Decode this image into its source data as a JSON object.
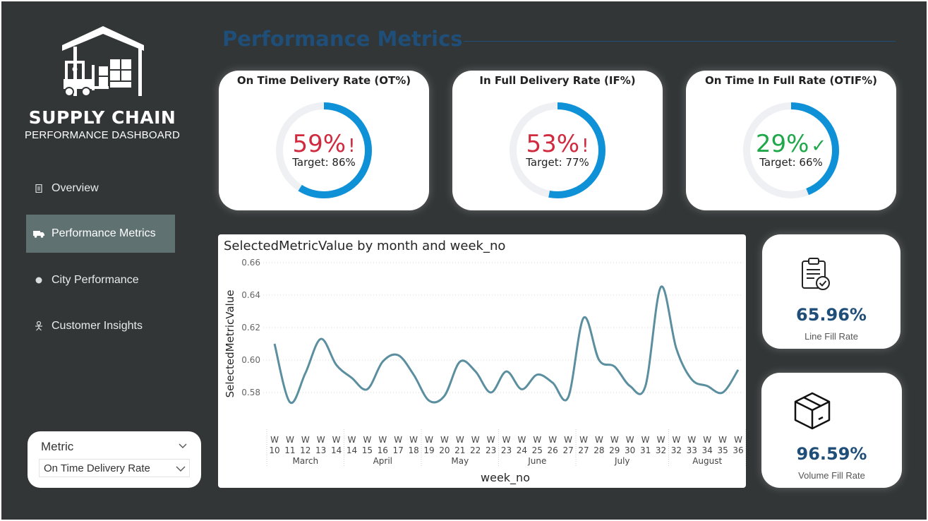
{
  "brand": {
    "title": "SUPPLY CHAIN",
    "subtitle": "PERFORMANCE DASHBOARD"
  },
  "nav": {
    "items": [
      {
        "label": "Overview",
        "icon": "document-icon",
        "active": false
      },
      {
        "label": "Performance Metrics",
        "icon": "truck-icon",
        "active": true
      },
      {
        "label": "City Performance",
        "icon": "location-dot-icon",
        "active": false
      },
      {
        "label": "Customer Insights",
        "icon": "person-icon",
        "active": false
      }
    ]
  },
  "slicer": {
    "title": "Metric",
    "selected": "On Time Delivery Rate"
  },
  "page": {
    "title": "Performance Metrics"
  },
  "colors": {
    "background": "#323637",
    "accent_blue": "#1f4e79",
    "ring_blue": "#0f91d8",
    "ring_track": "#eef0f4",
    "below_target": "#d02a3f",
    "above_target": "#1ea84a",
    "line": "#5b8fa0"
  },
  "kpis": [
    {
      "title": "On Time Delivery Rate (OT%)",
      "value": "59%",
      "flag": "!",
      "target": "Target: 86%",
      "status": "below",
      "fill": 0.59
    },
    {
      "title": "In Full Delivery Rate (IF%)",
      "value": "53%",
      "flag": "!",
      "target": "Target: 77%",
      "status": "below",
      "fill": 0.53
    },
    {
      "title": "On Time In Full Rate (OTIF%)",
      "value": "29%",
      "flag": "✓",
      "target": "Target: 66%",
      "status": "above",
      "fill": 0.44
    }
  ],
  "side_kpis": [
    {
      "value": "65.96%",
      "label": "Line Fill Rate",
      "icon": "clipboard-check-icon"
    },
    {
      "value": "96.59%",
      "label": "Volume Fill Rate",
      "icon": "box-icon"
    }
  ],
  "chart_data": {
    "type": "line",
    "title": "SelectedMetricValue by month and week_no",
    "xlabel": "week_no",
    "ylabel": "SelectedMetricValue",
    "ylim": [
      0.56,
      0.66
    ],
    "yticks": [
      "0.58",
      "0.60",
      "0.62",
      "0.64",
      "0.66"
    ],
    "categories": [
      "W 10",
      "W 11",
      "W 12",
      "W 13",
      "W 14",
      "W 14",
      "W 15",
      "W 16",
      "W 17",
      "W 18",
      "W 19",
      "W 20",
      "W 21",
      "W 22",
      "W 23",
      "W 23",
      "W 24",
      "W 25",
      "W 26",
      "W 27",
      "W 27",
      "W 28",
      "W 29",
      "W 30",
      "W 31",
      "W 32",
      "W 32",
      "W 33",
      "W 34",
      "W 35",
      "W 36"
    ],
    "groups": [
      {
        "name": "March",
        "count": 5
      },
      {
        "name": "April",
        "count": 5
      },
      {
        "name": "May",
        "count": 5
      },
      {
        "name": "June",
        "count": 5
      },
      {
        "name": "July",
        "count": 6
      },
      {
        "name": "August",
        "count": 5
      }
    ],
    "series": [
      {
        "values": [
          0.61,
          0.574,
          0.592,
          0.613,
          0.597,
          0.589,
          0.582,
          0.599,
          0.603,
          0.591,
          0.575,
          0.578,
          0.599,
          0.593,
          0.58,
          0.593,
          0.582,
          0.591,
          0.586,
          0.577,
          0.626,
          0.6,
          0.596,
          0.584,
          0.584,
          0.645,
          0.607,
          0.588,
          0.584,
          0.58,
          0.594
        ]
      }
    ],
    "grid": true
  }
}
